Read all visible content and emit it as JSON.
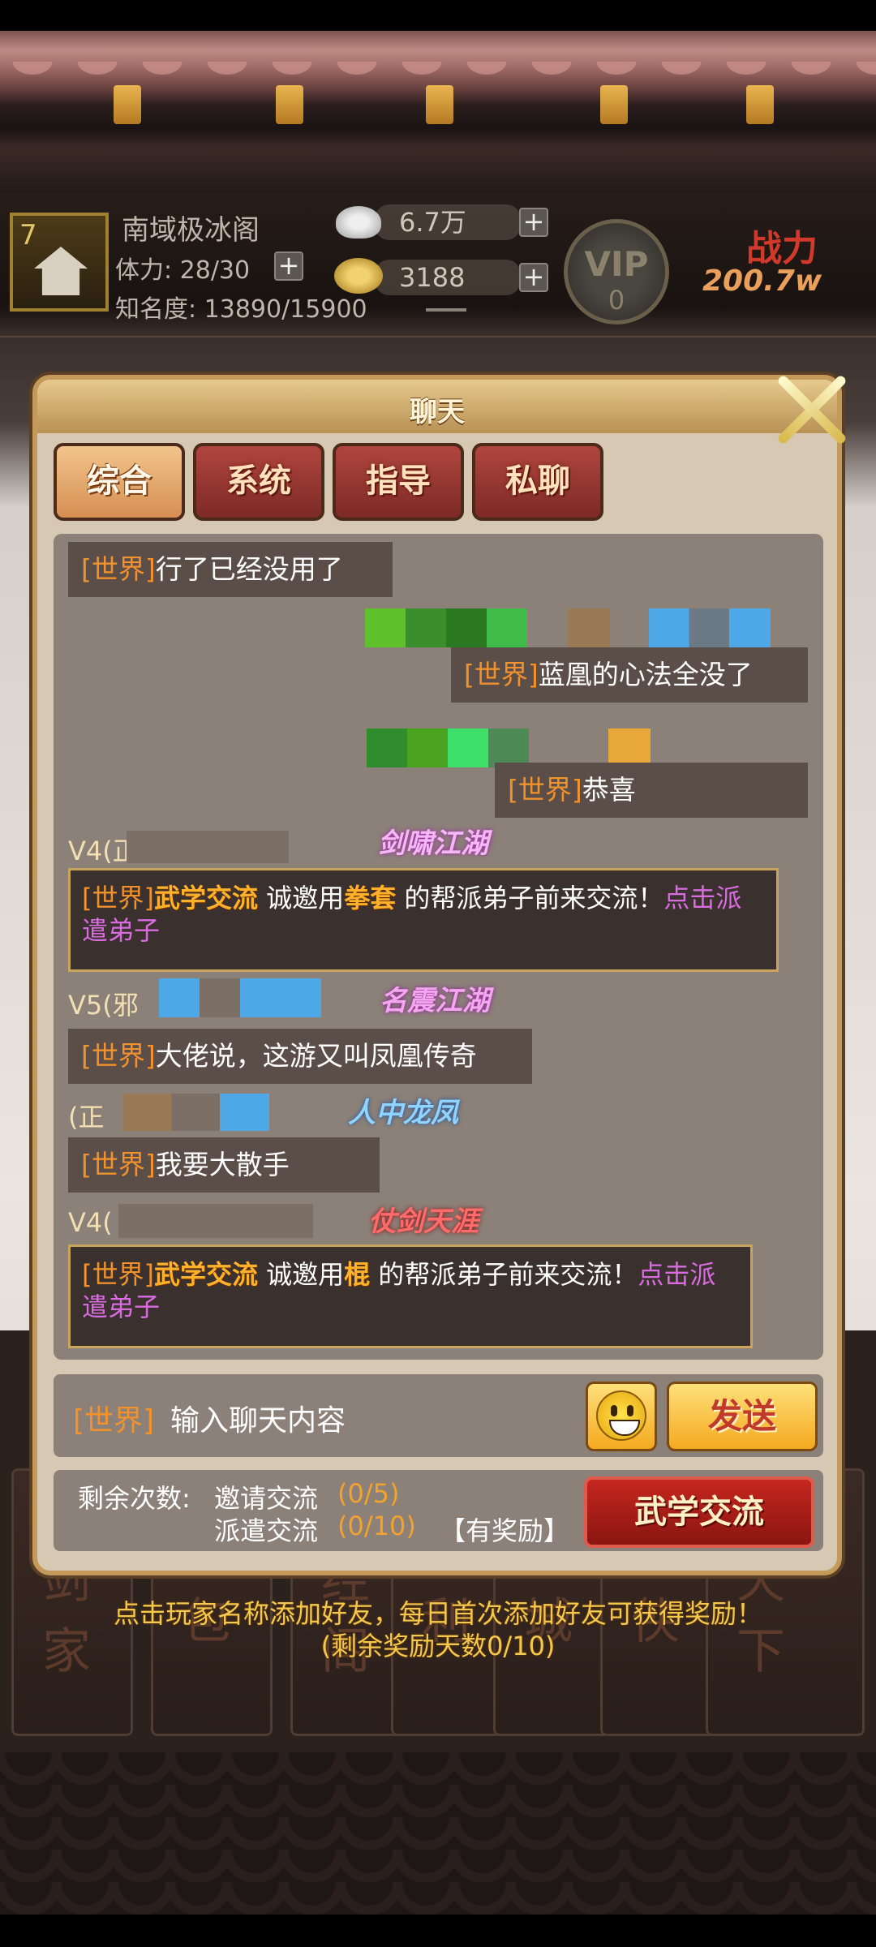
{
  "header": {
    "level": "7",
    "sect_name": "南域极冰阁",
    "stamina": "体力: 28/30",
    "fame": "知名度: 13890/15900",
    "silver": "6.7万",
    "gold": "3188",
    "vip_label": "VIP",
    "vip_level": "0",
    "power_label": "战力",
    "power_value": "200.7w"
  },
  "popup": {
    "title": "聊天",
    "tabs": [
      {
        "label": "综合",
        "active": true
      },
      {
        "label": "系统",
        "active": false
      },
      {
        "label": "指导",
        "active": false
      },
      {
        "label": "私聊",
        "active": false
      }
    ]
  },
  "chat": {
    "channel_tag": "[世界]",
    "messages": [
      {
        "text": "行了已经没用了"
      },
      {
        "text": "蓝凰的心法全没了"
      },
      {
        "text": "恭喜"
      },
      {
        "name": "V4(正",
        "title": "剑啸江湖",
        "pre": "诚邀用",
        "skill": "拳套",
        "post": "的帮派弟子前来交流！",
        "link": "点击派遣弟子",
        "event": "武学交流"
      },
      {
        "name": "V5(邪",
        "title": "名震江湖",
        "text": "大佬说，这游又叫凤凰传奇"
      },
      {
        "name": "(正",
        "title": "人中龙凤",
        "text": "我要大散手"
      },
      {
        "name": "V4(",
        "title": "仗剑天涯",
        "pre": "诚邀用",
        "skill": "棍",
        "post": "的帮派弟子前来交流！",
        "link": "点击派遣弟子",
        "event": "武学交流"
      }
    ]
  },
  "input": {
    "tag": "[世界]",
    "placeholder": "输入聊天内容",
    "send_label": "发送",
    "emoji_icon": "smile-emoji-icon"
  },
  "stats": {
    "remaining_label": "剩余次数:",
    "invite_label": "邀请交流",
    "invite_count": "(0/5)",
    "dispatch_label": "派遣交流",
    "dispatch_count": "(0/10)",
    "reward_label": "【有奖励】",
    "exchange_button": "武学交流"
  },
  "hint": {
    "line1": "点击玩家名称添加好友，每日首次添加好友可获得奖励！",
    "line2": "(剩余奖励天数0/10)"
  },
  "background_menu": [
    {
      "label": "天剑家"
    },
    {
      "label": "背包"
    },
    {
      "label": "藏经阁"
    },
    {
      "label": "福利"
    },
    {
      "label": "商城"
    },
    {
      "label": "寻侠"
    },
    {
      "label": "剑天下"
    }
  ],
  "colors": {
    "world_tag": "#f1922c",
    "highlight": "#ffb12a",
    "link": "#d86ce0",
    "tab_active": "#e4a86b",
    "tab_inactive": "#9c3a33"
  }
}
